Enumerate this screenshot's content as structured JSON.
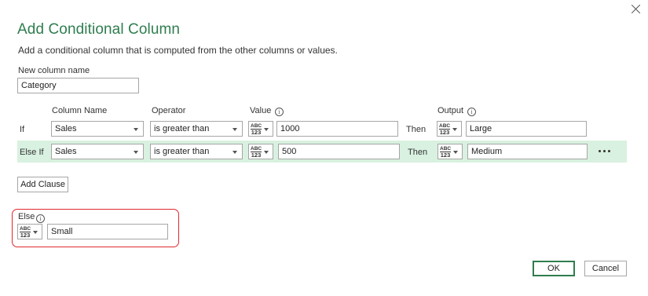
{
  "dialog": {
    "title": "Add Conditional Column",
    "description": "Add a conditional column that is computed from the other columns or values."
  },
  "new_column": {
    "label": "New column name",
    "value": "Category"
  },
  "headers": {
    "column_name": "Column Name",
    "operator": "Operator",
    "value": "Value",
    "output": "Output"
  },
  "type_icon": {
    "top": "ABC",
    "bottom": "123"
  },
  "clauses": [
    {
      "prefix": "If",
      "column": "Sales",
      "operator": "is greater than",
      "value": "1000",
      "then": "Then",
      "output": "Large"
    },
    {
      "prefix": "Else If",
      "column": "Sales",
      "operator": "is greater than",
      "value": "500",
      "then": "Then",
      "output": "Medium"
    }
  ],
  "add_clause_label": "Add Clause",
  "else_section": {
    "label": "Else",
    "value": "Small"
  },
  "buttons": {
    "ok": "OK",
    "cancel": "Cancel"
  },
  "colors": {
    "accent": "#2f7d4f",
    "highlight_row": "#d9f1e0",
    "annotation": "#e0282e"
  },
  "icons": [
    "close-icon",
    "info-icon",
    "type-selector-icon",
    "chevron-down-icon",
    "more-options-icon"
  ]
}
